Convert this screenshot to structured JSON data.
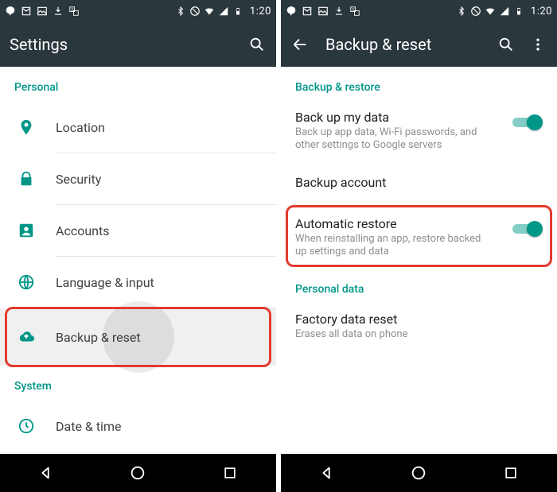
{
  "status": {
    "time": "1:20"
  },
  "left": {
    "title": "Settings",
    "section_personal": "Personal",
    "section_system": "System",
    "items": {
      "location": "Location",
      "security": "Security",
      "accounts": "Accounts",
      "language": "Language & input",
      "backup": "Backup & reset",
      "datetime": "Date & time"
    }
  },
  "right": {
    "title": "Backup & reset",
    "section_backup": "Backup & restore",
    "section_personal": "Personal data",
    "rows": {
      "backup_my_data": {
        "title": "Back up my data",
        "sub": "Back up app data, Wi-Fi passwords, and other settings to Google servers",
        "toggle": true
      },
      "backup_account": {
        "title": "Backup account"
      },
      "auto_restore": {
        "title": "Automatic restore",
        "sub": "When reinstalling an app, restore backed up settings and data",
        "toggle": true
      },
      "factory": {
        "title": "Factory data reset",
        "sub": "Erases all data on phone"
      }
    }
  }
}
